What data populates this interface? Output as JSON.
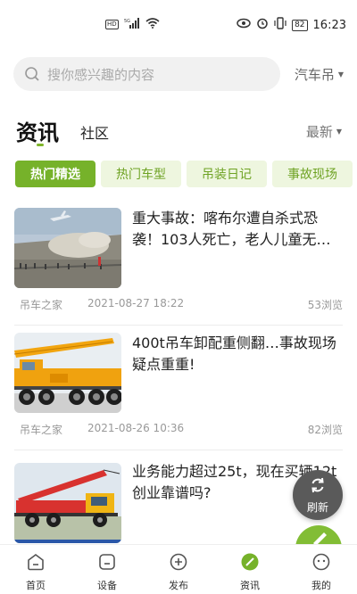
{
  "status_bar": {
    "left_icons": [
      "hd-icon",
      "signal-5g-icon",
      "wifi-icon"
    ],
    "hd_label": "HD",
    "net_label": "5G",
    "right_icons": [
      "eye-icon",
      "alarm-icon",
      "vibrate-icon",
      "battery-icon"
    ],
    "battery": "82",
    "time": "16:23"
  },
  "search": {
    "placeholder": "搜你感兴趣的内容",
    "category_select": "汽车吊"
  },
  "main_tabs": {
    "news": "资讯",
    "community": "社区",
    "sort": "最新"
  },
  "chips": [
    "热门精选",
    "热门车型",
    "吊装日记",
    "事故现场"
  ],
  "active_chip": "热门精选",
  "feed": [
    {
      "title": "重大事故：喀布尔遭自杀式恐袭！103人死亡，老人儿童无…",
      "source": "吊车之家",
      "date": "2021-08-27 18:22",
      "views": "53浏览",
      "thumb": "airport-scene"
    },
    {
      "title": "400t吊车卸配重侧翻…事故现场疑点重重!",
      "source": "吊车之家",
      "date": "2021-08-26 10:36",
      "views": "82浏览",
      "thumb": "yellow-crane"
    },
    {
      "title": "业务能力超过25t，现在买辆12t创业靠谱吗?",
      "source": "",
      "date": "",
      "views": "",
      "thumb": "red-crane"
    }
  ],
  "refresh_label": "刷新",
  "bottom_nav": [
    {
      "label": "首页",
      "icon": "home-icon"
    },
    {
      "label": "设备",
      "icon": "device-icon"
    },
    {
      "label": "发布",
      "icon": "plus-circle-icon"
    },
    {
      "label": "资讯",
      "icon": "news-icon",
      "active": true
    },
    {
      "label": "我的",
      "icon": "profile-icon"
    }
  ],
  "colors": {
    "accent": "#76b22a",
    "chip_bg": "#eef6df",
    "chip_text": "#6fa324"
  }
}
